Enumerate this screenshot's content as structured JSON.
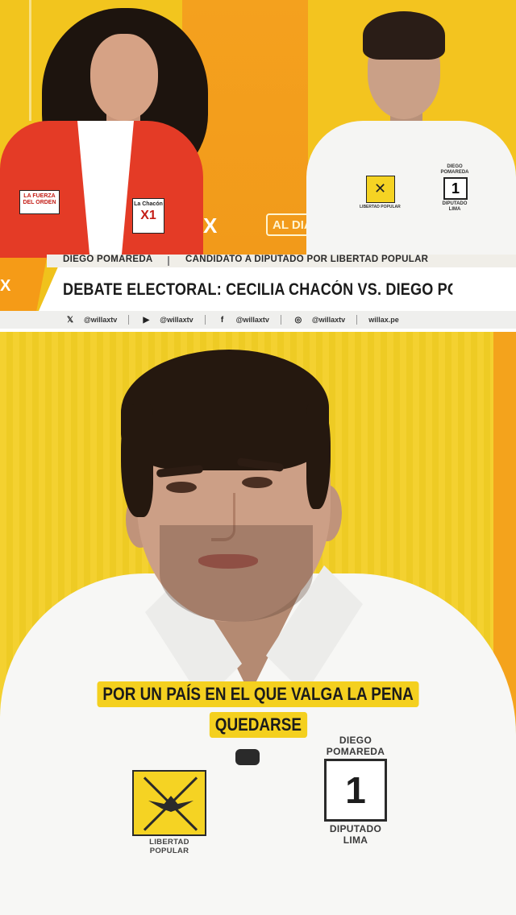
{
  "broadcast": {
    "channel_logo": "X",
    "program_tag": "AL DIA",
    "guest_left": {
      "badge_party": "LA FUERZA DEL ORDEN",
      "badge_name": "La Chacón",
      "badge_number": "X1"
    },
    "guest_right": {
      "party_label": "LIBERTAD POPULAR",
      "name_label": "DIEGO POMAREDA",
      "number": "1",
      "role_label": "DIPUTADO LIMA"
    },
    "lower_third": {
      "speaker_name": "DIEGO POMAREDA",
      "speaker_role": "CANDIDATO A DIPUTADO POR LIBERTAD POPULAR",
      "headline": "DEBATE ELECTORAL: CECILIA CHACÓN VS. DIEGO POMAREDA",
      "side_logo": "X"
    },
    "social": [
      {
        "icon": "x-icon",
        "glyph": "𝕏",
        "handle": "@willaxtv"
      },
      {
        "icon": "youtube-icon",
        "glyph": "▶",
        "handle": "@willaxtv"
      },
      {
        "icon": "facebook-icon",
        "glyph": "f",
        "handle": "@willaxtv"
      },
      {
        "icon": "instagram-icon",
        "glyph": "◎",
        "handle": "@willaxtv"
      },
      {
        "icon": "web-icon",
        "glyph": "",
        "handle": "willax.pe"
      }
    ]
  },
  "closeup": {
    "party_logo_label": "LIBERTAD POPULAR",
    "candidate_name": "DIEGO POMAREDA",
    "candidate_number": "1",
    "candidate_role": "DIPUTADO LIMA"
  },
  "subtitle": {
    "line1": "POR UN PAÍS EN EL QUE VALGA LA PENA",
    "line2": "QUEDARSE"
  },
  "colors": {
    "background_yellow": "#f3cf25",
    "accent_orange": "#f59b17",
    "jacket_red": "#e43b26",
    "subtitle_bg": "#f4d01f"
  }
}
